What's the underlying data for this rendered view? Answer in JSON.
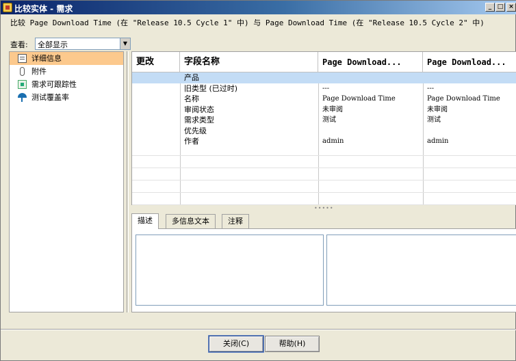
{
  "window": {
    "title": "比较实体 - 需求",
    "min": "_",
    "max": "□",
    "close": "×"
  },
  "compare_line": "比较 Page Download Time (在 \"Release 10.5 Cycle 1\" 中) 与 Page Download Time (在 \"Release 10.5 Cycle 2\" 中)",
  "view": {
    "label": "查看:",
    "selected": "全部显示"
  },
  "nav": {
    "items": [
      {
        "label": "详细信息",
        "icon": "details-icon"
      },
      {
        "label": "附件",
        "icon": "attachment-icon"
      },
      {
        "label": "需求可跟踪性",
        "icon": "traceability-icon"
      },
      {
        "label": "测试覆盖率",
        "icon": "coverage-icon"
      }
    ]
  },
  "grid": {
    "headers": [
      "更改",
      "字段名称",
      "Page Download...",
      "Page Download..."
    ],
    "rows": [
      {
        "field": "产品",
        "left": "",
        "right": ""
      },
      {
        "field": "旧类型 (已过时)",
        "left": "---",
        "right": "---"
      },
      {
        "field": "名称",
        "left": "Page Download Time",
        "right": "Page Download Time"
      },
      {
        "field": "审阅状态",
        "left": "未审阅",
        "right": "未审阅"
      },
      {
        "field": "需求类型",
        "left": "测试",
        "right": "测试"
      },
      {
        "field": "优先级",
        "left": "",
        "right": ""
      },
      {
        "field": "作者",
        "left": "admin",
        "right": "admin"
      }
    ]
  },
  "tabs": [
    "描述",
    "多信息文本",
    "注释"
  ],
  "buttons": {
    "close": "关闭(C)",
    "help": "帮助(H)"
  },
  "colors": {
    "selected_nav": "#fcc98d",
    "selected_row": "#c3dcf5",
    "title_bar": "#0a246a"
  }
}
